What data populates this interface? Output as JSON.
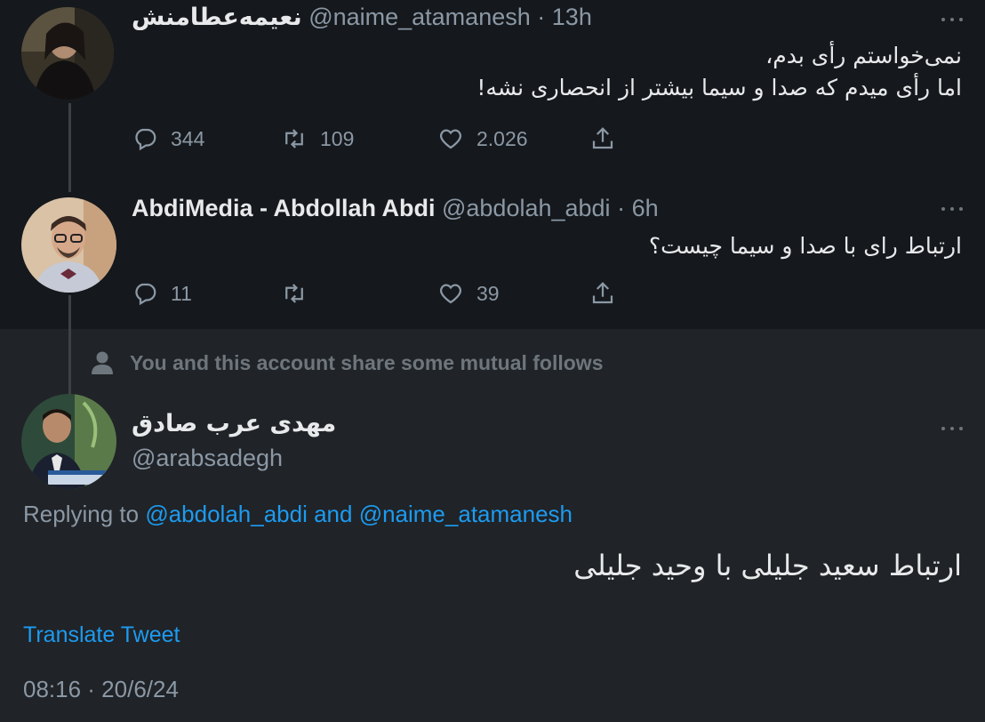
{
  "thread": [
    {
      "display_name": "نعیمه‌عطامنش",
      "handle": "@naime_atamanesh",
      "sep": "·",
      "time": "13h",
      "text_lines": [
        "نمی‌خواستم رأی بدم،",
        "اما رأی میدم که صدا و سیما بیشتر از انحصاری نشه!"
      ],
      "actions": {
        "reply": "344",
        "retweet": "109",
        "like": "2.026"
      }
    },
    {
      "display_name": "AbdiMedia - Abdollah Abdi",
      "handle": "@abdolah_abdi",
      "sep": "·",
      "time": "6h",
      "text_lines": [
        "ارتباط رای با صدا و سیما چیست؟"
      ],
      "actions": {
        "reply": "11",
        "retweet": "",
        "like": "39"
      }
    }
  ],
  "mutual_follows": "You and this account share some mutual follows",
  "focus_tweet": {
    "display_name": "مهدی عرب صادق",
    "handle": "@arabsadegh",
    "replying_prefix": "Replying to ",
    "replying_user1": "@abdolah_abdi",
    "replying_and": " and ",
    "replying_user2": "@naime_atamanesh",
    "text": "ارتباط سعید جلیلی با وحید جلیلی",
    "translate": "Translate Tweet",
    "timestamp": "08:16 · 20/6/24"
  },
  "icons": [
    "reply-icon",
    "retweet-icon",
    "like-icon",
    "share-icon",
    "more-icon",
    "person-icon"
  ],
  "colors": {
    "background": "#15181c",
    "focus_background": "#202327",
    "accent": "#1d9bf0",
    "secondary_text": "#8b98a5"
  }
}
